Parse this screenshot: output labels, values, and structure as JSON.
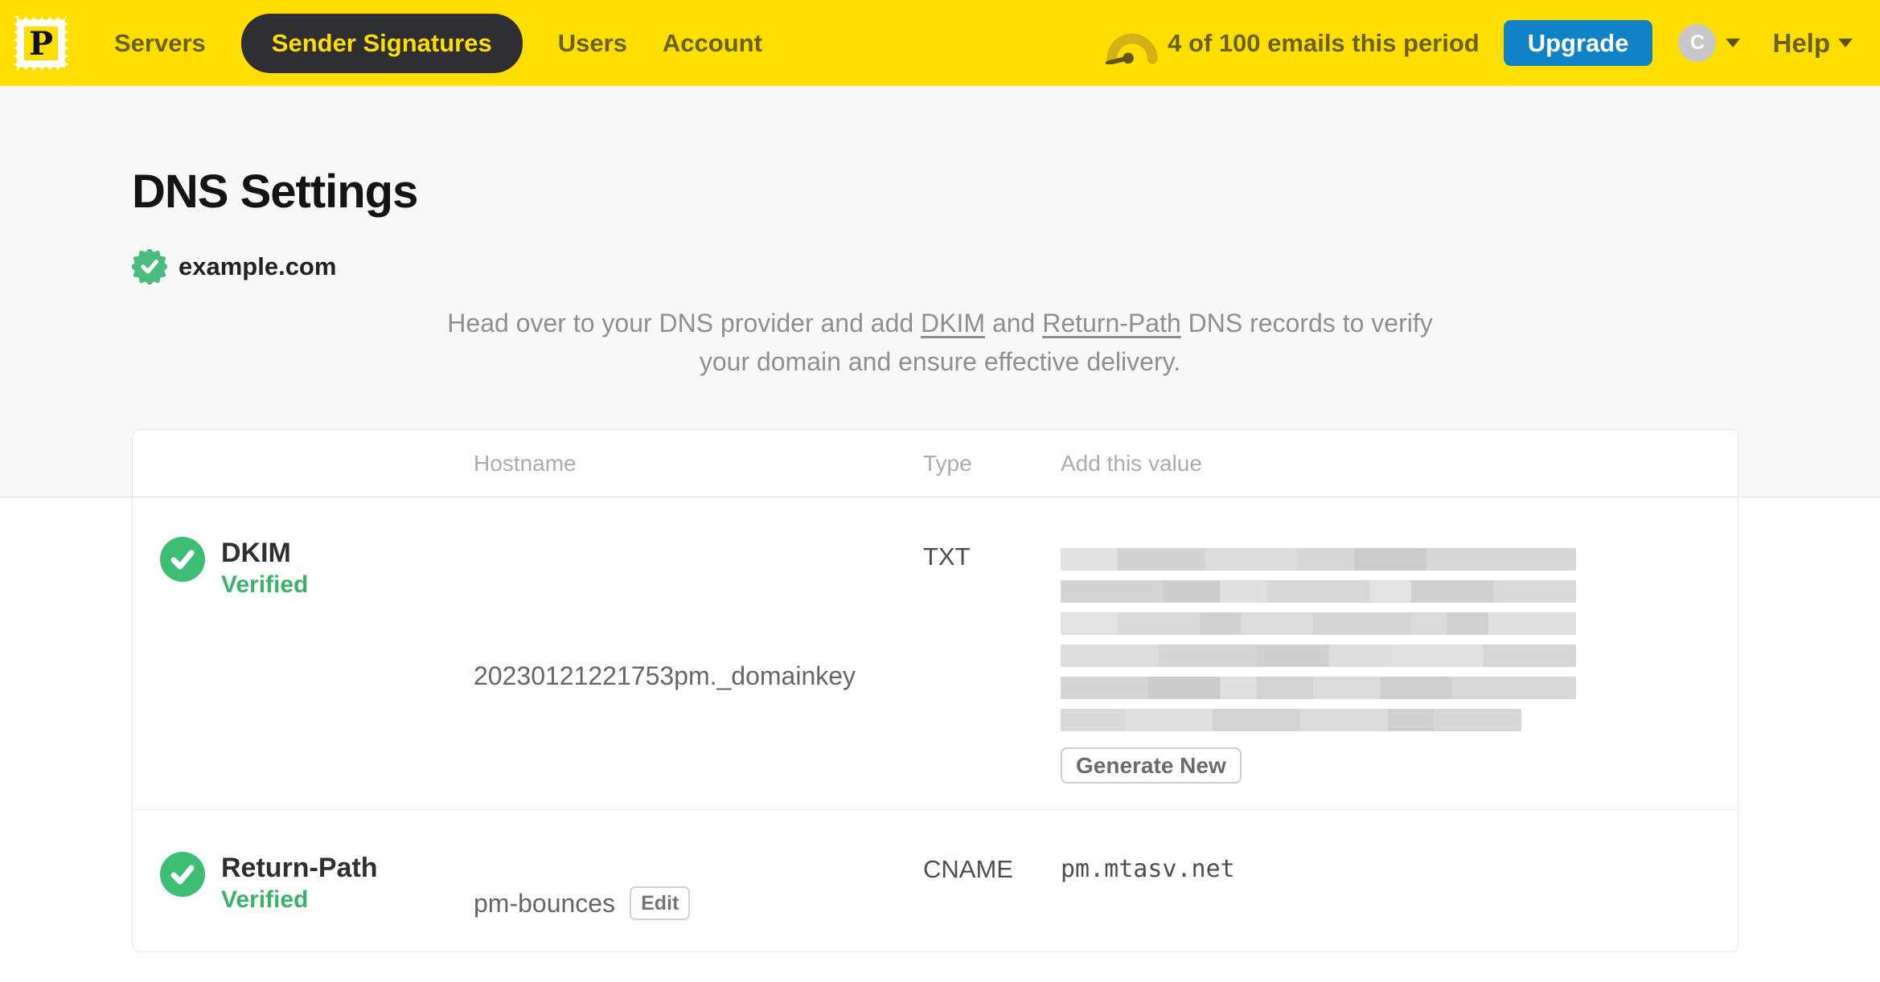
{
  "nav": {
    "logo_letter": "P",
    "items": [
      {
        "label": "Servers",
        "active": false
      },
      {
        "label": "Sender Signatures",
        "active": true
      },
      {
        "label": "Users",
        "active": false
      },
      {
        "label": "Account",
        "active": false
      }
    ],
    "usage_text": "4 of 100 emails this period",
    "upgrade_label": "Upgrade",
    "avatar_initial": "C",
    "help_label": "Help"
  },
  "page": {
    "title": "DNS Settings",
    "domain": "example.com",
    "domain_verified": true,
    "intro": {
      "part1": "Head over to your DNS provider and add ",
      "link_dkim": "DKIM",
      "part2": " and ",
      "link_return_path": "Return-Path",
      "part3": " DNS records to verify your domain and ensure effective delivery."
    }
  },
  "table": {
    "headers": {
      "hostname": "Hostname",
      "type": "Type",
      "value": "Add this value"
    },
    "rows": [
      {
        "name": "DKIM",
        "status": "Verified",
        "hostname": "20230121221753pm._domainkey",
        "type": "TXT",
        "value_redacted": true,
        "redacted_lines": 6,
        "action_label": "Generate New"
      },
      {
        "name": "Return-Path",
        "status": "Verified",
        "hostname": "pm-bounces",
        "edit_label": "Edit",
        "type": "CNAME",
        "value": "pm.mtasv.net"
      }
    ]
  },
  "colors": {
    "brand_yellow": "#FFDE00",
    "nav_text": "#6B6114",
    "active_pill_bg": "#2F2F33",
    "upgrade_blue": "#1182C6",
    "verified_green": "#3EBE75",
    "status_text_green": "#3BB269",
    "hero_bg": "#F8F8F8",
    "card_border": "#E8E8E8"
  }
}
